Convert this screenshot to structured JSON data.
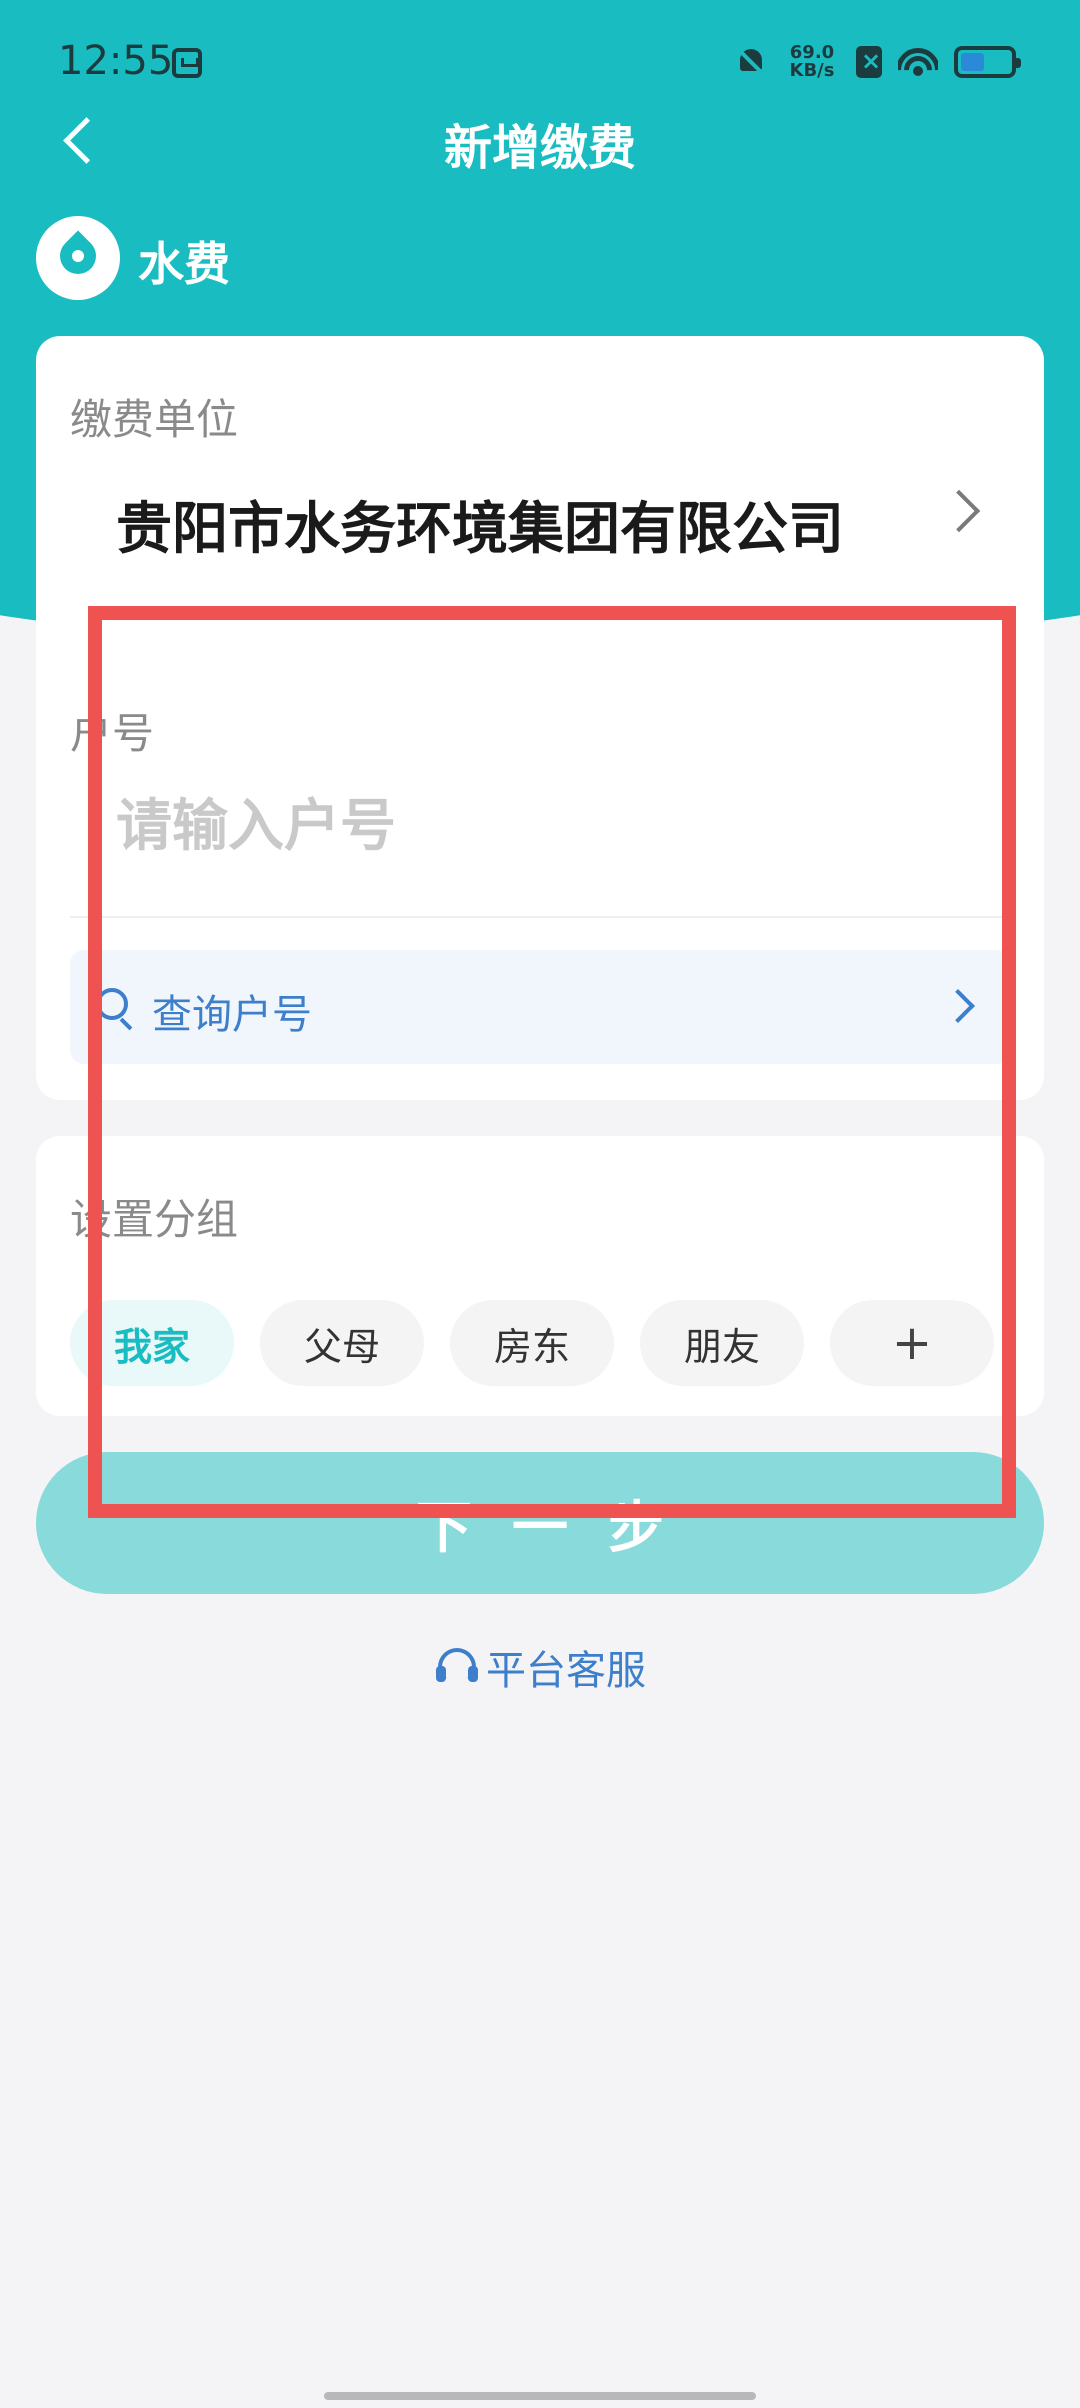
{
  "status_bar": {
    "time": "12:55",
    "net_speed_value": "69.0",
    "net_speed_unit": "KB/s"
  },
  "header": {
    "title": "新增缴费",
    "category": "水费"
  },
  "form": {
    "unit_label": "缴费单位",
    "unit_value": "贵阳市水务环境集团有限公司",
    "account_label": "户号",
    "account_placeholder": "请输入户号",
    "query_label": "查询户号"
  },
  "group": {
    "label": "设置分组",
    "tags": [
      "我家",
      "父母",
      "房东",
      "朋友"
    ],
    "add_label": "+"
  },
  "actions": {
    "next_label": "下一步",
    "support_label": "平台客服"
  },
  "colors": {
    "accent": "#19bcc1",
    "link": "#3d7fcb",
    "highlight": "#ee5351"
  }
}
